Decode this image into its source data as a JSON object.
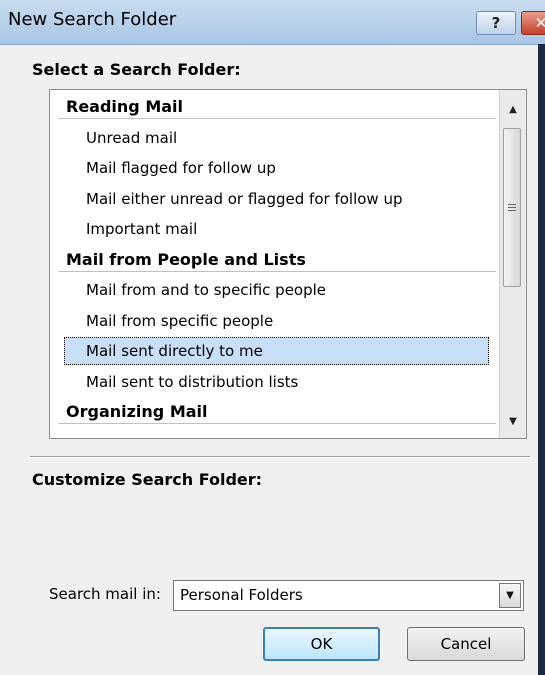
{
  "window": {
    "title": "New Search Folder",
    "help_glyph": "?",
    "close_glyph": "✕"
  },
  "select_label": "Select a Search Folder:",
  "list": {
    "rows": [
      {
        "type": "header",
        "label": "Reading Mail"
      },
      {
        "type": "item",
        "label": "Unread mail"
      },
      {
        "type": "item",
        "label": "Mail flagged for follow up"
      },
      {
        "type": "item",
        "label": "Mail either unread or flagged for follow up"
      },
      {
        "type": "item",
        "label": "Important mail"
      },
      {
        "type": "header",
        "label": "Mail from People and Lists"
      },
      {
        "type": "item",
        "label": "Mail from and to specific people"
      },
      {
        "type": "item",
        "label": "Mail from specific people"
      },
      {
        "type": "item",
        "label": "Mail sent directly to me",
        "selected": true
      },
      {
        "type": "item",
        "label": "Mail sent to distribution lists"
      },
      {
        "type": "header",
        "label": "Organizing Mail"
      }
    ],
    "scroll_up": "▲",
    "scroll_down": "▼"
  },
  "customize_label": "Customize Search Folder:",
  "search_mail_in": {
    "label": "Search mail in:",
    "value": "Personal Folders",
    "dropdown_glyph": "▼"
  },
  "buttons": {
    "ok": "OK",
    "cancel": "Cancel"
  }
}
